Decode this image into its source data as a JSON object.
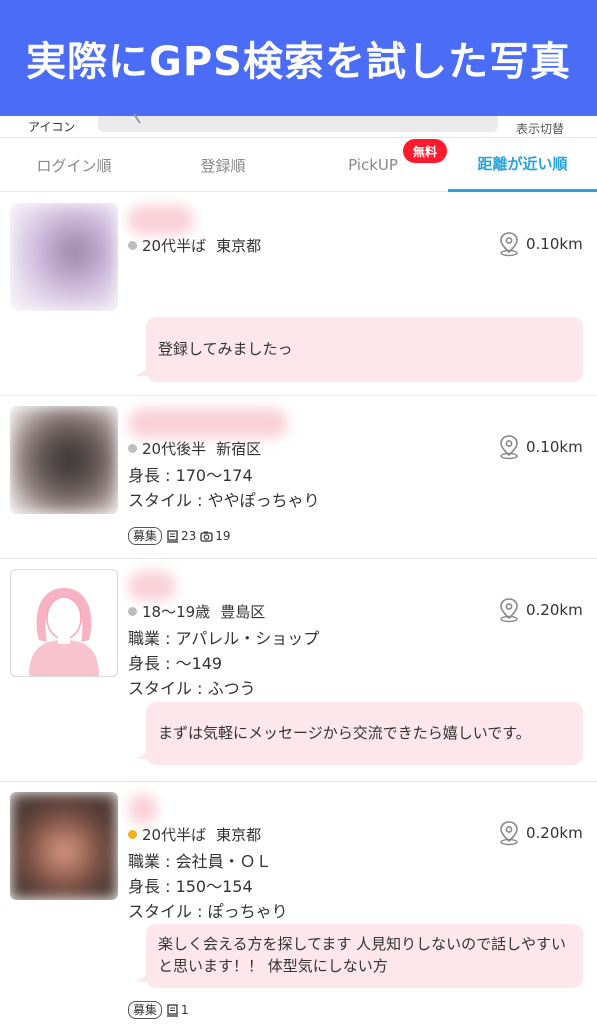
{
  "banner": {
    "title": "実際にGPS検索を試した写真"
  },
  "search": {
    "icon_label": "アイコン",
    "view_toggle": "表示切替"
  },
  "tabs": [
    {
      "label": "ログイン順"
    },
    {
      "label": "登録順"
    },
    {
      "label": "PickUP",
      "badge": "無料"
    },
    {
      "label": "距離が近い順",
      "active": true
    }
  ],
  "colors": {
    "banner": "#4a6cf7",
    "accent": "#2aa3d8",
    "badge": "#ff1a2e",
    "bubble": "#fde6ec"
  },
  "users": [
    {
      "age": "20代半ば",
      "area": "東京都",
      "status": "offline",
      "distance": "0.10km",
      "message": "登録してみましたっ"
    },
    {
      "age": "20代後半",
      "area": "新宿区",
      "status": "offline",
      "distance": "0.10km",
      "height": "身長 : 170～174",
      "style": "スタイル : ややぽっちゃり",
      "recruit": "募集",
      "board_count": "23",
      "photo_count": "19"
    },
    {
      "age": "18～19歳",
      "area": "豊島区",
      "status": "offline",
      "distance": "0.20km",
      "job": "職業 : アパレル・ショップ",
      "height": "身長 : ～149",
      "style": "スタイル : ふつう",
      "message": "まずは気軽にメッセージから交流できたら嬉しいです。"
    },
    {
      "age": "20代半ば",
      "area": "東京都",
      "status": "online",
      "distance": "0.20km",
      "job": "職業 : 会社員・ＯＬ",
      "height": "身長 : 150～154",
      "style": "スタイル : ぽっちゃり",
      "message": "楽しく会える方を探してます 人見知りしないので話しやすいと思います！！ 体型気にしない方",
      "recruit": "募集",
      "board_count": "1"
    }
  ]
}
